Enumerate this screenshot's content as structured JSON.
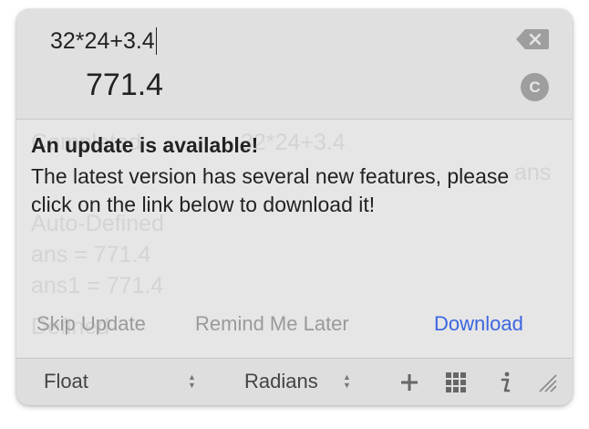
{
  "calculator": {
    "expression": "32*24+3.4",
    "result": "771.4",
    "clear_label": "C"
  },
  "history": {
    "rows": [
      {
        "left": "Completed",
        "right": "32*24+3.4"
      },
      {
        "left": "",
        "right": "ans"
      },
      {
        "left": "Auto-Defined",
        "right": ""
      },
      {
        "left": "ans = 771.4",
        "right": ""
      },
      {
        "left": "ans1 = 771.4",
        "right": ""
      },
      {
        "left": "Defined",
        "right": ""
      }
    ]
  },
  "update": {
    "title": "An update is available!",
    "message": "The latest version has several new features, please click on the link below to download it!",
    "skip_label": "Skip Update",
    "remind_label": "Remind Me Later",
    "download_label": "Download"
  },
  "footer": {
    "number_mode": "Float",
    "angle_mode": "Radians"
  },
  "colors": {
    "accent": "#3c66e0",
    "panel": "#e6e6e6",
    "header": "#e0e0e0"
  },
  "icons": [
    "backspace-icon",
    "clear-icon",
    "plus-icon",
    "grid-icon",
    "info-icon",
    "resize-handle-icon",
    "up-down-arrows-icon"
  ]
}
